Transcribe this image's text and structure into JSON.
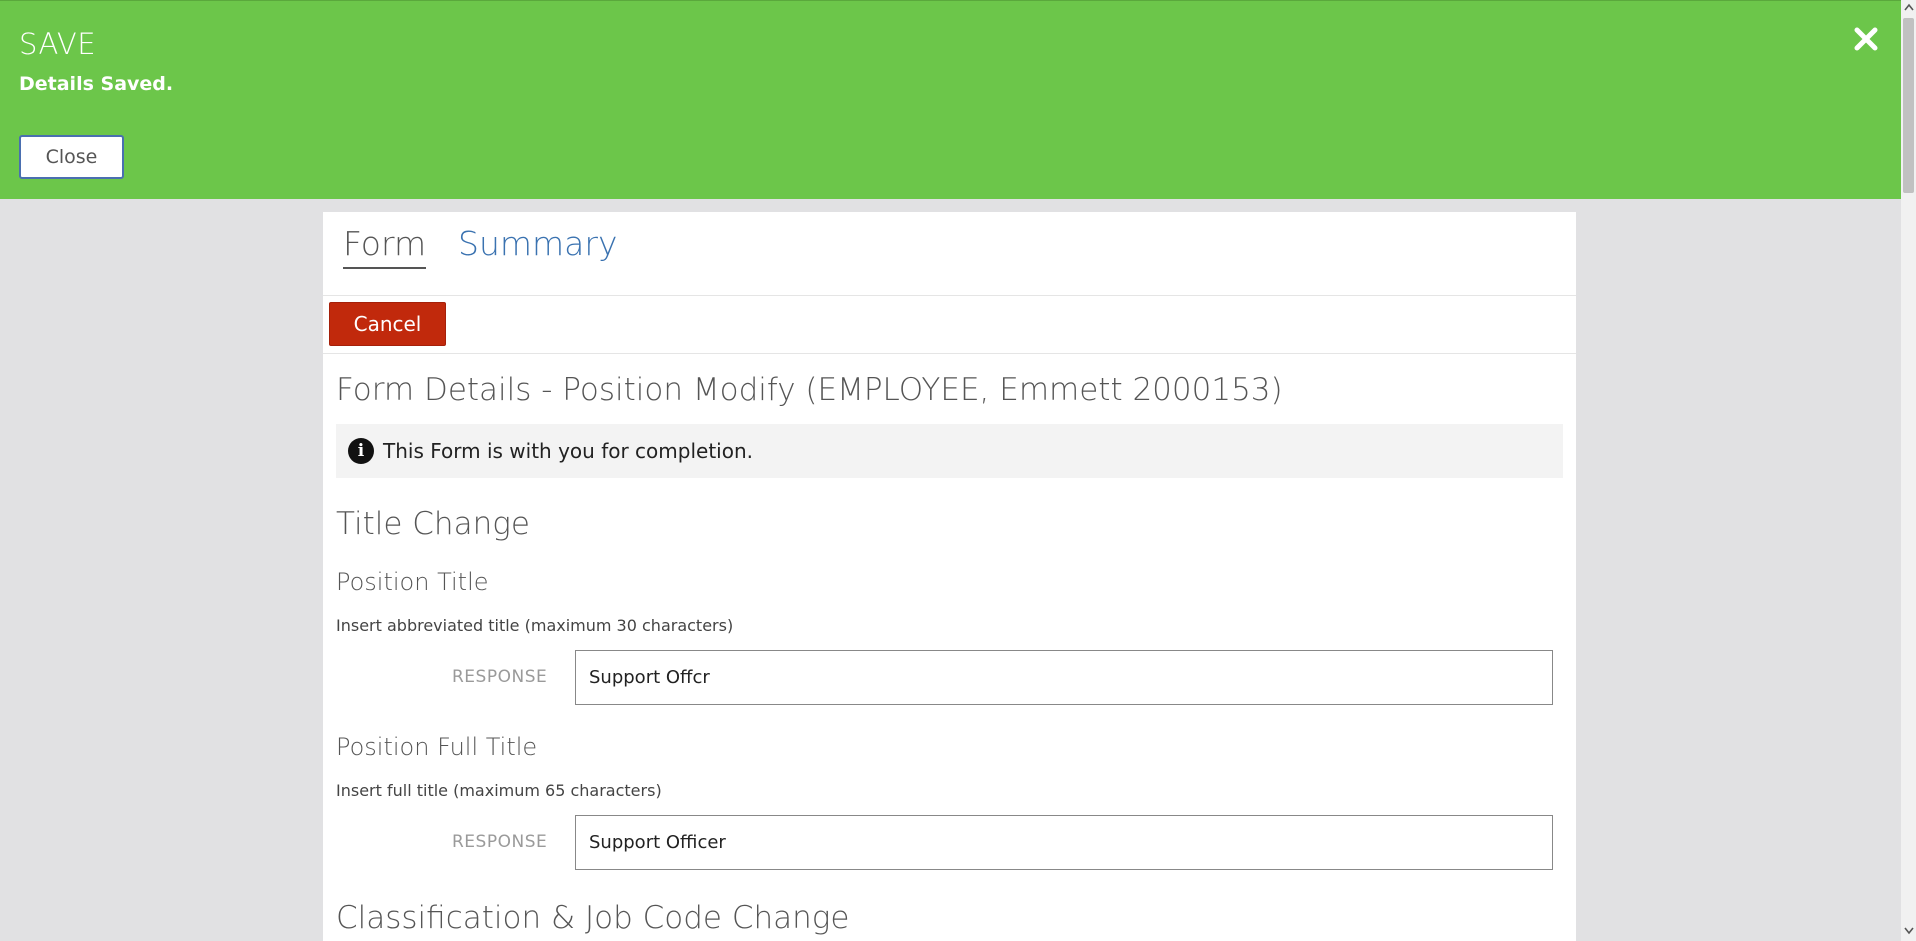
{
  "notification": {
    "title": "SAVE",
    "message": "Details Saved.",
    "close_button": "Close",
    "dismiss_icon": "close-icon",
    "color": "#6cc64a"
  },
  "tabs": [
    {
      "label": "Form",
      "active": true
    },
    {
      "label": "Summary",
      "active": false
    }
  ],
  "toolbar": {
    "cancel_label": "Cancel",
    "cancel_color": "#c1290c"
  },
  "form": {
    "heading": "Form Details - Position Modify (EMPLOYEE, Emmett 2000153)",
    "info_icon": "info-icon",
    "info_message": "This Form is with you for completion.",
    "section1_title": "Title Change",
    "questions": [
      {
        "title": "Position Title",
        "help": "Insert abbreviated title (maximum 30 characters)",
        "response_label": "RESPONSE",
        "value": "Support Offcr"
      },
      {
        "title": "Position Full Title",
        "help": "Insert full title (maximum 65 characters)",
        "response_label": "RESPONSE",
        "value": "Support Officer"
      }
    ],
    "section2_title": "Classification & Job Code Change"
  }
}
